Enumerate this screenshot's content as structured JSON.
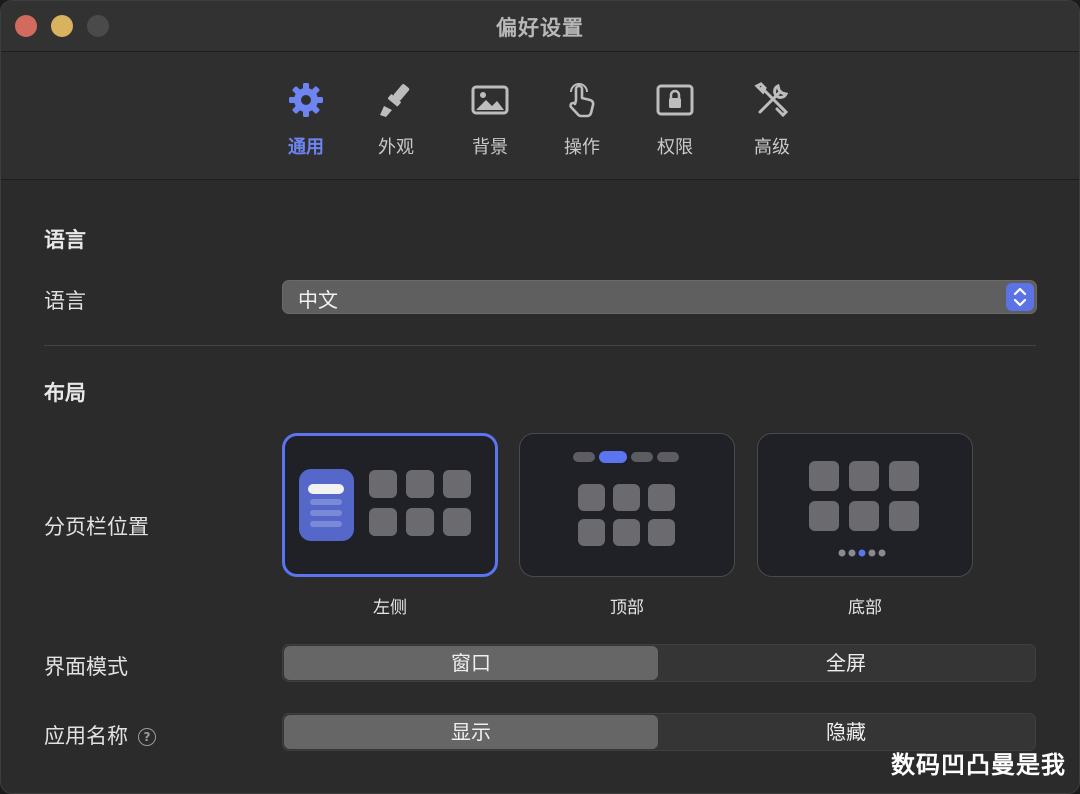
{
  "window": {
    "title": "偏好设置"
  },
  "tabs": [
    {
      "label": "通用",
      "icon": "gear-icon",
      "active": true
    },
    {
      "label": "外观",
      "icon": "paintbrush-icon",
      "active": false
    },
    {
      "label": "背景",
      "icon": "photo-icon",
      "active": false
    },
    {
      "label": "操作",
      "icon": "hand-pointer-icon",
      "active": false
    },
    {
      "label": "权限",
      "icon": "lock-icon",
      "active": false
    },
    {
      "label": "高级",
      "icon": "tools-icon",
      "active": false
    }
  ],
  "language": {
    "section_title": "语言",
    "row_label": "语言",
    "selected_value": "中文"
  },
  "layout": {
    "section_title": "布局",
    "tab_position_label": "分页栏位置",
    "tab_position_options": [
      {
        "label": "左侧",
        "selected": true
      },
      {
        "label": "顶部",
        "selected": false
      },
      {
        "label": "底部",
        "selected": false
      }
    ],
    "interface_mode_label": "界面模式",
    "interface_mode_options": [
      "窗口",
      "全屏"
    ],
    "interface_mode_selected": "窗口",
    "app_name_label": "应用名称",
    "app_name_options": [
      "显示",
      "隐藏"
    ],
    "app_name_selected": "显示"
  },
  "watermark": "数码凹凸曼是我",
  "colors": {
    "accent": "#5b74ef",
    "window_bg": "#2b2b2b",
    "close": "#d26b5e",
    "minimize": "#d8b25f"
  }
}
